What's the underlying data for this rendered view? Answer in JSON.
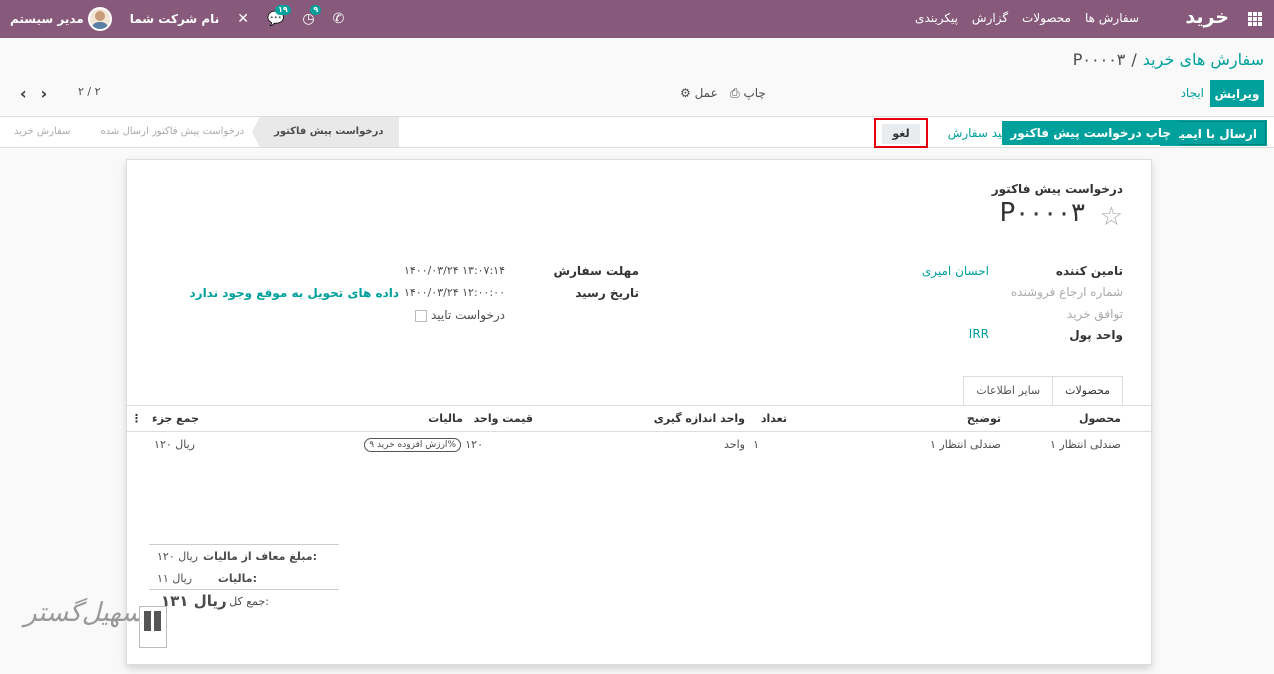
{
  "navbar": {
    "app_name": "خرید",
    "menu": [
      "سفارش ها",
      "محصولات",
      "گزارش",
      "پیکربندی"
    ],
    "user_name": "مدیر سیستم",
    "company": "نام شرکت شما",
    "messages_badge": "۱۹",
    "activities_badge": "۹"
  },
  "breadcrumb": {
    "parent": "سفارش های خرید",
    "separator": "/",
    "current": "P۰۰۰۰۳"
  },
  "controls": {
    "edit": "ویرایش",
    "create": "ایجاد",
    "print": "چاپ",
    "action": "عمل",
    "pager": "۲ / ۲"
  },
  "statusbar": {
    "send_email": "ارسال با ایمیل",
    "print_rfq": "چاپ درخواست پیش فاکتور",
    "confirm": "تایید سفارش",
    "cancel": "لغو",
    "stages": [
      "درخواست پیش فاکتور",
      "درخواست پیش فاکتور ارسال شده",
      "سفارش خرید"
    ],
    "active_stage": "درخواست پیش فاکتور"
  },
  "form": {
    "doc_type": "درخواست پیش فاکتور",
    "name": "P۰۰۰۰۳",
    "vendor_label": "تامین کننده",
    "vendor": "احسان امیری",
    "vendor_ref_label": "شماره ارجاع فروشنده",
    "agreement_label": "توافق خرید",
    "currency_label": "واحد پول",
    "currency": "IRR",
    "order_deadline_label": "مهلت سفارش",
    "order_deadline": "۱۴۰۰/۰۳/۲۴ ۱۳:۰۷:۱۴",
    "receipt_date_label": "تاریخ رسید",
    "receipt_date": "۱۴۰۰/۰۳/۲۴ ۱۲:۰۰:۰۰",
    "on_time_note": "داده های تحویل به موقع وجود ندارد",
    "ask_confirm_label": "درخواست تایید"
  },
  "tabs": [
    "محصولات",
    "سایر اطلاعات"
  ],
  "table": {
    "headers": {
      "product": "محصول",
      "description": "توضیح",
      "qty": "تعداد",
      "uom": "واحد اندازه گیری",
      "price": "قیمت واحد",
      "taxes": "مالیات",
      "subtotal": "جمع جزء"
    },
    "rows": [
      {
        "product": "صندلی انتظار ۱",
        "description": "صندلی انتظار ۱",
        "qty": "۱",
        "uom": "واحد",
        "price": "۱۲۰",
        "taxes": "ارزش افزوده خرید ۹%",
        "subtotal": "۱۲۰ ریال"
      }
    ]
  },
  "totals": {
    "untaxed_label": "مبلغ معاف از مالیات:",
    "untaxed": "۱۲۰ ریال",
    "tax_label": "مالیات:",
    "tax": "۱۱ ریال",
    "total_label": "جمع کل:",
    "total": "۱۳۱ ریال"
  },
  "watermark": "تسهیل‌گستر"
}
